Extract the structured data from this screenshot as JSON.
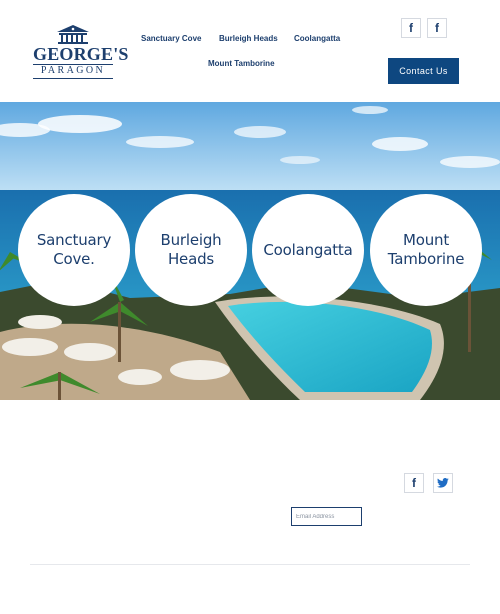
{
  "header": {
    "logo": {
      "name": "GEORGE'S",
      "subtitle": "PARAGON"
    },
    "nav": [
      {
        "label": "Sanctuary Cove"
      },
      {
        "label": "Burleigh Heads"
      },
      {
        "label": "Coolangatta"
      },
      {
        "label": "Mount Tamborine"
      }
    ],
    "social": [
      {
        "icon": "facebook-icon",
        "glyph": "f"
      },
      {
        "icon": "facebook-icon",
        "glyph": "f"
      }
    ],
    "contact_label": "Contact Us"
  },
  "hero": {
    "locations": [
      {
        "label": "Sanctuary\nCove."
      },
      {
        "label": "Burleigh\nHeads"
      },
      {
        "label": "Coolangatta"
      },
      {
        "label": "Mount\nTamborine"
      }
    ]
  },
  "footer": {
    "social": [
      {
        "icon": "facebook-icon",
        "glyph": "f"
      },
      {
        "icon": "twitter-icon"
      }
    ],
    "email_placeholder": "Email Address"
  },
  "colors": {
    "brand_navy": "#1d3f6e",
    "button_blue": "#0e4780",
    "bird_blue": "#1f6cc4"
  }
}
